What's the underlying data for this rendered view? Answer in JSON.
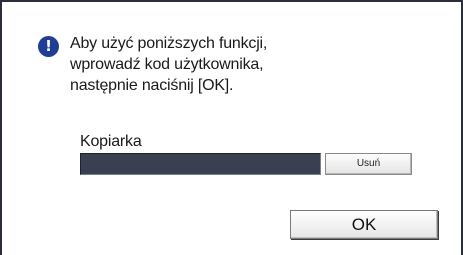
{
  "dialog": {
    "icon": "info-icon",
    "icon_glyph": "!",
    "message_lines": [
      "Aby użyć poniższych funkcji,",
      "wprowadź kod użytkownika,",
      "następnie naciśnij [OK]."
    ],
    "section_label": "Kopiarka",
    "code_field_value": "",
    "delete_label": "Usuń",
    "ok_label": "OK"
  },
  "colors": {
    "icon_bg": "#1f3f94",
    "field_bg": "#3a3f52",
    "frame": "#2b2f3a"
  }
}
